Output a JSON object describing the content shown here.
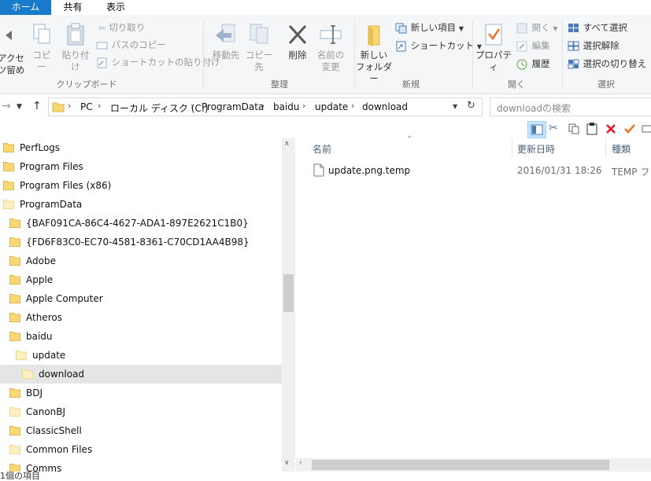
{
  "tabs": [
    {
      "label": "ホーム",
      "active": true
    },
    {
      "label": "共有",
      "active": false
    },
    {
      "label": "表示",
      "active": false
    }
  ],
  "ribbon": {
    "clipboard": {
      "pin_label_1": "アクセ",
      "pin_label_2": "ツ留め",
      "copy": "コピー",
      "paste": "貼り付け",
      "cut": "切り取り",
      "copy_path": "パスのコピー",
      "paste_shortcut": "ショートカットの貼り付け",
      "group": "クリップボード"
    },
    "organize": {
      "move_to": "移動先",
      "copy_to": "コピー先",
      "delete": "削除",
      "rename_1": "名前の",
      "rename_2": "変更",
      "group": "整理"
    },
    "new": {
      "new_folder_1": "新しい",
      "new_folder_2": "フォルダー",
      "new_item": "新しい項目",
      "shortcut": "ショートカット",
      "group": "新規"
    },
    "open": {
      "properties": "プロパティ",
      "open": "開く",
      "edit": "編集",
      "history": "履歴",
      "group": "開く"
    },
    "select": {
      "select_all": "すべて選択",
      "select_none": "選択解除",
      "invert": "選択の切り替え",
      "group": "選択"
    }
  },
  "address": {
    "crumbs": [
      "PC",
      "ローカル ディスク (C:)",
      "ProgramData",
      "baidu",
      "update",
      "download"
    ],
    "search_placeholder": "downloadの検索"
  },
  "tree": [
    {
      "label": "PerfLogs",
      "indent": 0
    },
    {
      "label": "Program Files",
      "indent": 0
    },
    {
      "label": "Program Files (x86)",
      "indent": 0
    },
    {
      "label": "ProgramData",
      "indent": 0,
      "pale": true
    },
    {
      "label": "{BAF091CA-86C4-4627-ADA1-897E2621C1B0}",
      "indent": 1
    },
    {
      "label": "{FD6F83C0-EC70-4581-8361-C70CD1AA4B98}",
      "indent": 1
    },
    {
      "label": "Adobe",
      "indent": 1
    },
    {
      "label": "Apple",
      "indent": 1
    },
    {
      "label": "Apple Computer",
      "indent": 1
    },
    {
      "label": "Atheros",
      "indent": 1
    },
    {
      "label": "baidu",
      "indent": 1
    },
    {
      "label": "update",
      "indent": 2,
      "pale": true
    },
    {
      "label": "download",
      "indent": 3,
      "pale": true,
      "selected": true
    },
    {
      "label": "BDJ",
      "indent": 1
    },
    {
      "label": "CanonBJ",
      "indent": 1,
      "pale": true
    },
    {
      "label": "ClassicShell",
      "indent": 1
    },
    {
      "label": "Common Files",
      "indent": 1,
      "pale": true
    },
    {
      "label": "Comms",
      "indent": 1
    }
  ],
  "list": {
    "columns": {
      "name": "名前",
      "modified": "更新日時",
      "type": "種類"
    },
    "files": [
      {
        "name": "update.png.temp",
        "modified": "2016/01/31 18:26",
        "type": "TEMP ファ"
      }
    ]
  },
  "status": {
    "text": "1個の項目"
  },
  "colors": {
    "accent": "#1979ca",
    "folder": "#f8d775",
    "delete_red": "#e81123"
  }
}
